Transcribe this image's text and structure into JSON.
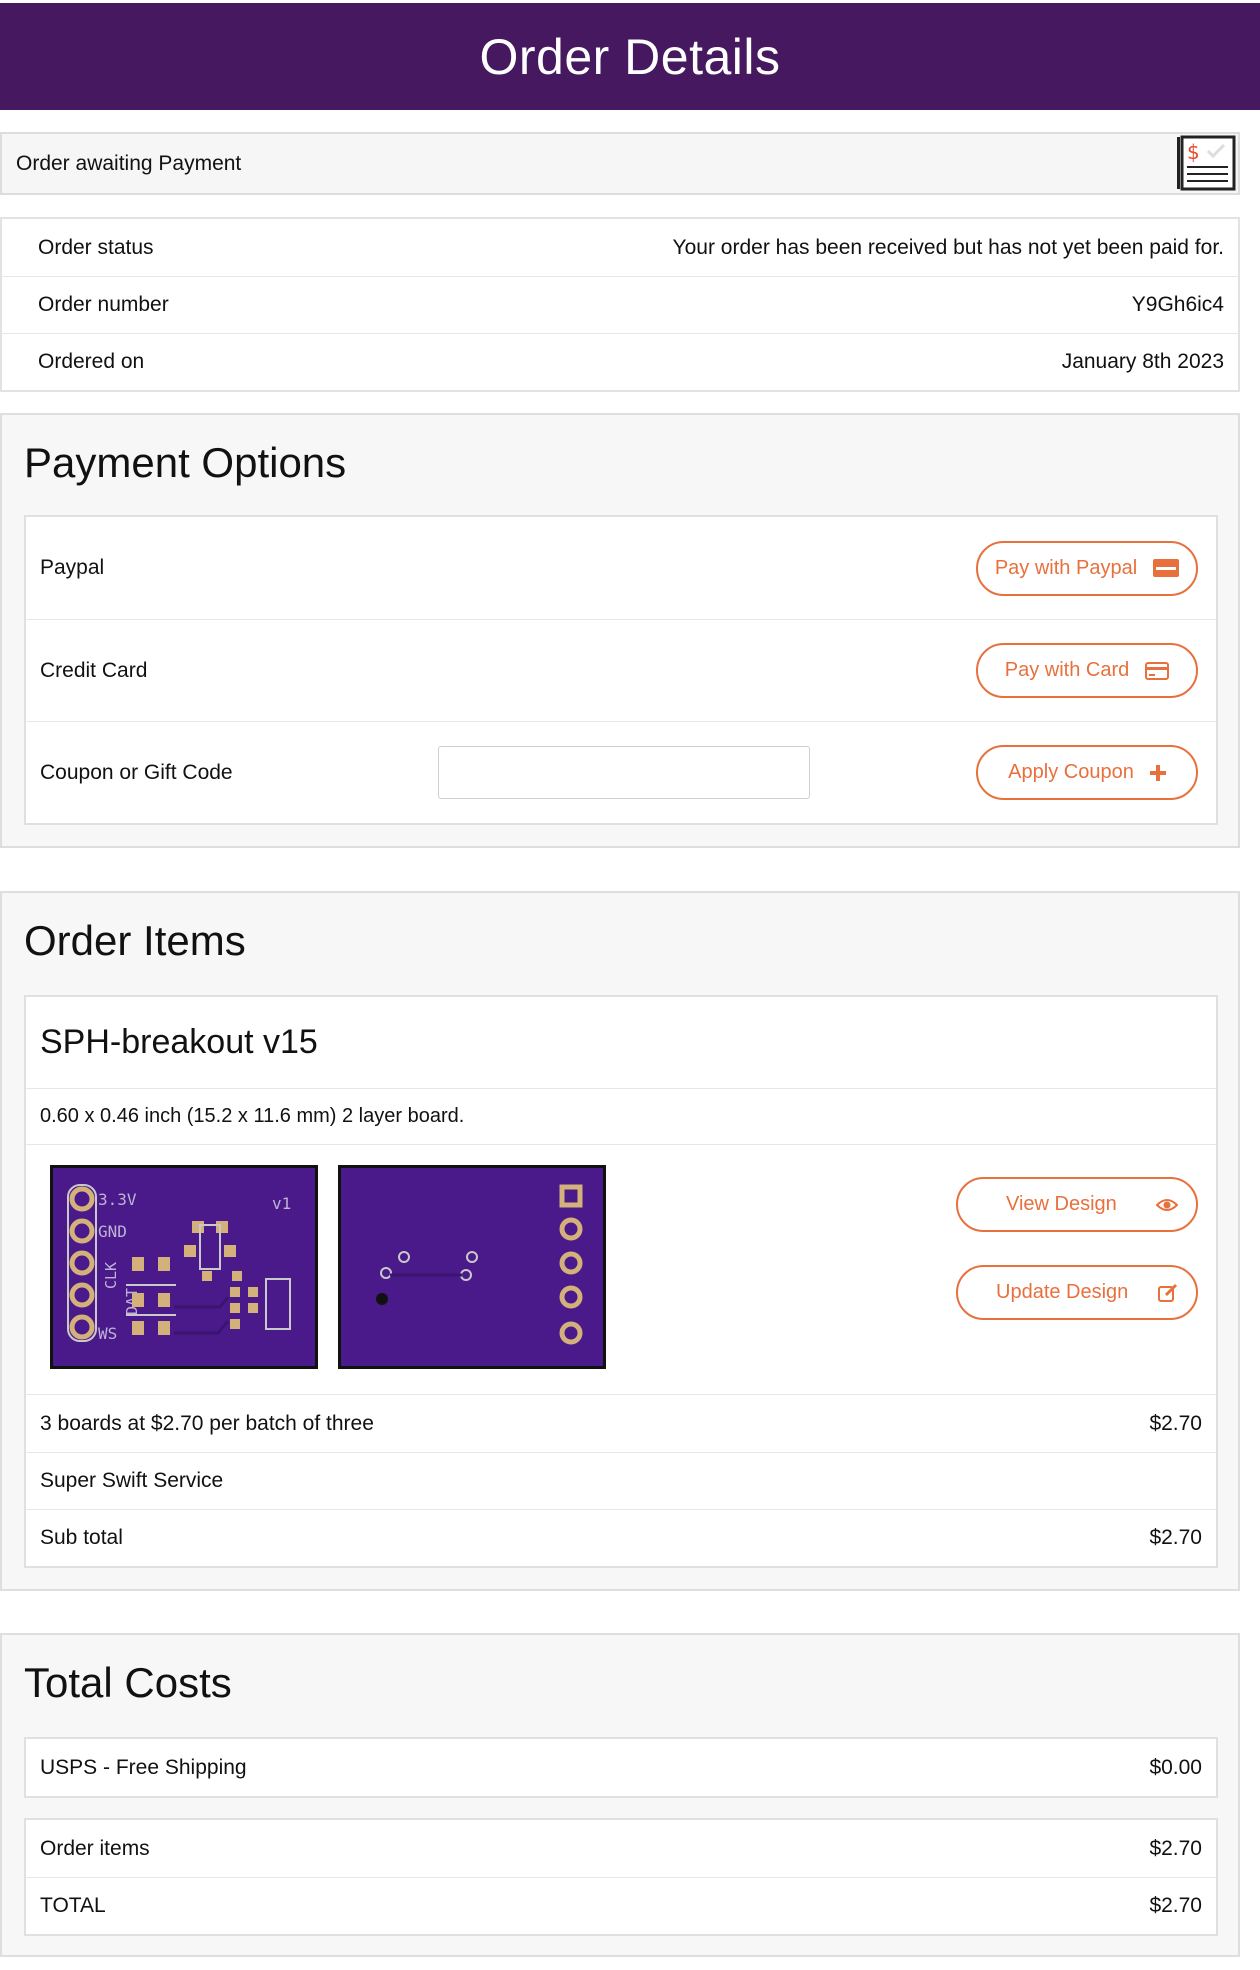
{
  "header": {
    "title": "Order Details"
  },
  "alert": {
    "text": "Order awaiting Payment",
    "icon": "invoice-dollar-icon"
  },
  "order_info": [
    {
      "label": "Order status",
      "value": "Your order has been received but has not yet been paid for."
    },
    {
      "label": "Order number",
      "value": "Y9Gh6ic4"
    },
    {
      "label": "Ordered on",
      "value": "January 8th 2023"
    }
  ],
  "payment": {
    "title": "Payment Options",
    "paypal_label": "Paypal",
    "paypal_button": "Pay with Paypal",
    "card_label": "Credit Card",
    "card_button": "Pay with Card",
    "coupon_label": "Coupon or Gift Code",
    "coupon_value": "",
    "coupon_button": "Apply Coupon"
  },
  "items": {
    "title": "Order Items",
    "item_name": "SPH-breakout v15",
    "item_desc": "0.60 x 0.46 inch (15.2 x 11.6 mm) 2 layer board.",
    "view_button": "View Design",
    "update_button": "Update Design",
    "pcb_labels": [
      "3.3V",
      "GND",
      "CLK",
      "DAT",
      "WS",
      "v1"
    ],
    "rows": [
      {
        "label": "3 boards at $2.70 per batch of three",
        "value": "$2.70"
      },
      {
        "label": "Super Swift Service",
        "value": ""
      },
      {
        "label": "Sub total",
        "value": "$2.70"
      }
    ]
  },
  "totals": {
    "title": "Total Costs",
    "shipping": {
      "label": "USPS - Free Shipping",
      "value": "$0.00"
    },
    "order_items": {
      "label": "Order items",
      "value": "$2.70"
    },
    "total": {
      "label": "TOTAL",
      "value": "$2.70"
    }
  },
  "colors": {
    "header": "#45185f",
    "accent": "#e8703d",
    "pcb": "#4a1a8a"
  }
}
